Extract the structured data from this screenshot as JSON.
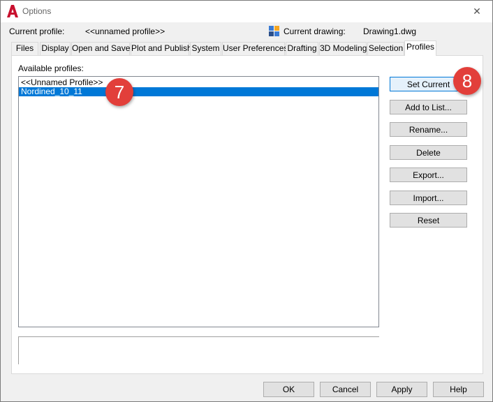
{
  "window": {
    "title": "Options",
    "close_glyph": "✕"
  },
  "header": {
    "current_profile_label": "Current profile:",
    "current_profile_value": "<<unnamed profile>>",
    "current_drawing_label": "Current drawing:",
    "current_drawing_value": "Drawing1.dwg"
  },
  "tabs": [
    {
      "label": "Files"
    },
    {
      "label": "Display"
    },
    {
      "label": "Open and Save"
    },
    {
      "label": "Plot and Publish"
    },
    {
      "label": "System"
    },
    {
      "label": "User Preferences"
    },
    {
      "label": "Drafting"
    },
    {
      "label": "3D Modeling"
    },
    {
      "label": "Selection"
    },
    {
      "label": "Profiles"
    }
  ],
  "active_tab": "Profiles",
  "profiles": {
    "label": "Available profiles:",
    "items": [
      {
        "label": "<<Unnamed Profile>>"
      },
      {
        "label": "Nordined_10_11"
      }
    ],
    "selected": "Nordined_10_11"
  },
  "side_buttons": [
    {
      "label": "Set Current"
    },
    {
      "label": "Add to List..."
    },
    {
      "label": "Rename..."
    },
    {
      "label": "Delete"
    },
    {
      "label": "Export..."
    },
    {
      "label": "Import..."
    },
    {
      "label": "Reset"
    }
  ],
  "footer": {
    "ok": "OK",
    "cancel": "Cancel",
    "apply": "Apply",
    "help": "Help"
  },
  "annotations": {
    "step_7": "7",
    "step_8": "8"
  },
  "colors": {
    "accent": "#0078d7",
    "badge": "#e23f3a",
    "app_icon": "#c8102e"
  }
}
